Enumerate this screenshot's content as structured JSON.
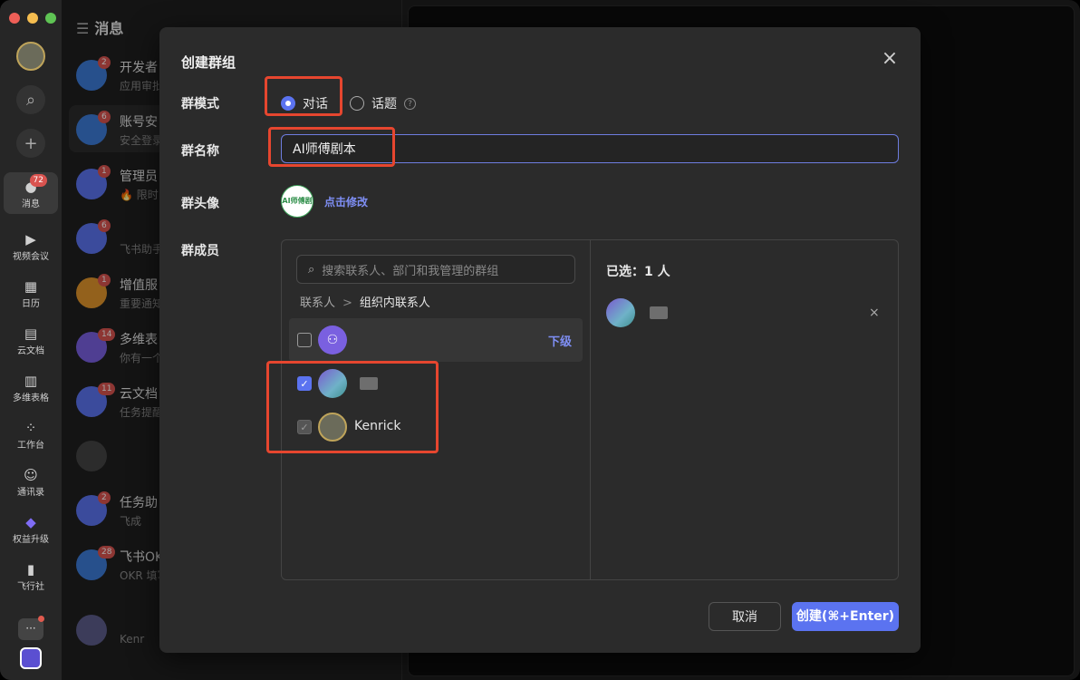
{
  "rail": {
    "items": [
      {
        "label": "消息",
        "badge": "72",
        "icon": "chat-icon"
      },
      {
        "label": "视频会议",
        "icon": "video-icon"
      },
      {
        "label": "日历",
        "icon": "calendar-icon"
      },
      {
        "label": "云文档",
        "icon": "doc-icon"
      },
      {
        "label": "多维表格",
        "icon": "table-icon"
      },
      {
        "label": "工作台",
        "icon": "grid-icon"
      },
      {
        "label": "通讯录",
        "icon": "contacts-icon"
      },
      {
        "label": "权益升级",
        "icon": "diamond-icon"
      },
      {
        "label": "飞行社",
        "icon": "book-icon"
      }
    ],
    "more": "···"
  },
  "list": {
    "title": "消息",
    "rows": [
      {
        "title": "开发者",
        "sub": "应用审批",
        "badge": "2",
        "color": "#3d7bd8"
      },
      {
        "title": "账号安",
        "sub": "安全登录",
        "badge": "6",
        "color": "#3d7bd8"
      },
      {
        "title": "管理员",
        "sub": "🔥 限时",
        "badge": "1",
        "color": "#5b73f0"
      },
      {
        "title": "",
        "sub": "飞书助手",
        "badge": "6",
        "color": "#5b73f0"
      },
      {
        "title": "增值服",
        "sub": "重要通知",
        "badge": "1",
        "color": "#e2962b"
      },
      {
        "title": "多维表",
        "sub": "你有一个",
        "badge": "14",
        "color": "#7a60e0"
      },
      {
        "title": "云文档",
        "sub": "任务提醒",
        "badge": "11",
        "color": "#5b73f0"
      },
      {
        "title": "",
        "sub": "",
        "badge": "",
        "color": "#444"
      },
      {
        "title": "任务助",
        "sub": "飞成",
        "badge": "2",
        "color": "#5b73f0"
      },
      {
        "title": "飞书OK",
        "sub": "OKR 填写",
        "badge": "28",
        "color": "#3d7bd8"
      },
      {
        "title": "",
        "sub": "Kenr",
        "badge": "",
        "color": "#5c5c8a"
      }
    ]
  },
  "modal": {
    "title": "创建群组",
    "mode_label": "群模式",
    "mode_options": [
      {
        "label": "对话",
        "selected": true
      },
      {
        "label": "话题",
        "selected": false
      }
    ],
    "help_icon": "?",
    "name_label": "群名称",
    "name_value": "AI师傅剧本",
    "avatar_label": "群头像",
    "avatar_text": "AI师傅剧",
    "avatar_edit": "点击修改",
    "members_label": "群成员",
    "search_placeholder": "搜索联系人、部门和我管理的群组",
    "breadcrumb": {
      "root": "联系人",
      "current": "组织内联系人"
    },
    "org_sub_link": "下级",
    "members": [
      {
        "name": "",
        "checked": true,
        "disabled": false
      },
      {
        "name": "Kenrick",
        "checked": true,
        "disabled": true
      }
    ],
    "selected_title": "已选：1 人",
    "cancel": "取消",
    "create": "创建(⌘+Enter)",
    "close_icon": "×"
  }
}
